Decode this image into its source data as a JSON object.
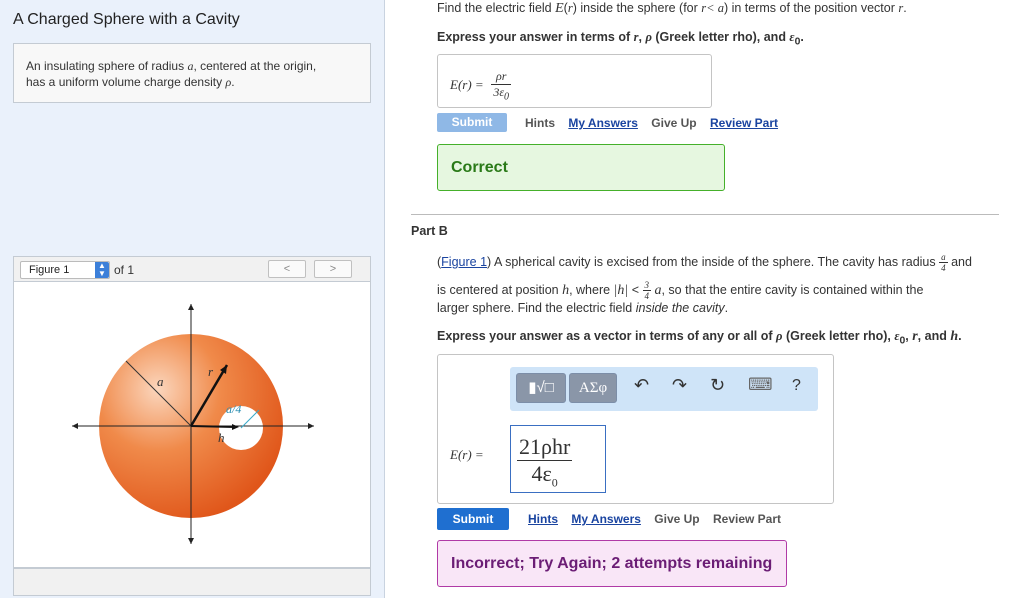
{
  "left": {
    "title": "A Charged Sphere with a Cavity",
    "intro_text_1": "An insulating sphere of radius ",
    "intro_var_a": "a",
    "intro_text_2": ", centered at the origin,",
    "intro_text_3": "has a uniform volume charge density ",
    "intro_var_rho": "ρ",
    "intro_text_4": ".",
    "figure_select": "Figure 1",
    "figure_of": "of 1",
    "figure_prev": "<",
    "figure_next": ">",
    "figure_labels": {
      "a": "a",
      "r": "r",
      "h": "h",
      "cavity_radius": "a/4"
    }
  },
  "partA": {
    "prompt_pre": "Find the electric field ",
    "prompt_E": "E",
    "prompt_r": "r",
    "prompt_mid": " inside the sphere (for ",
    "prompt_cond": "r< a",
    "prompt_post": ") in terms of the position vector ",
    "prompt_r2": "r",
    "prompt_end": ".",
    "express": "Express your answer in terms of ",
    "express_r": "r",
    "express_rho": "ρ",
    "express_mid": " (Greek letter rho), and ",
    "express_eps": "ε",
    "express_eps_sub": "0",
    "express_end": ".",
    "answer_lhs": "E(r) =",
    "answer_num": "ρr",
    "answer_den": "3ε",
    "answer_den_sub": "0",
    "submit": "Submit",
    "hints": "Hints",
    "my_answers": "My Answers",
    "give_up": "Give Up",
    "review_part": "Review Part",
    "feedback": "Correct"
  },
  "partB": {
    "heading": "Part B",
    "figure_link": "Figure 1",
    "text_1": ") A spherical cavity is excised from the inside of the sphere. The cavity has radius ",
    "frac_a": "a",
    "frac_4": "4",
    "text_and": " and",
    "text_2": "is centered at position ",
    "h": "h",
    "text_3": ", where ",
    "abs_h": "|h|",
    "lt": " < ",
    "frac_3": "3",
    "frac_4b": "4",
    "a2": "a",
    "text_4": ", so that the entire cavity is contained within the",
    "text_5": "larger sphere. Find the electric field ",
    "inside_cavity": "inside the cavity",
    "text_6": ".",
    "express_1": "Express your answer as a vector in terms of any or all of ",
    "rho": "ρ",
    "express_2": " (Greek letter rho), ",
    "eps": "ε",
    "eps_sub": "0",
    "comma": ", ",
    "r": "r",
    "express_3": ", and ",
    "h2": "h",
    "express_end": ".",
    "toolbar_template": "▮√□",
    "toolbar_greek": "ΑΣφ",
    "toolbar_undo": "↶",
    "toolbar_redo": "↷",
    "toolbar_reset": "↻",
    "toolbar_keyboard": "⌨",
    "toolbar_help": "?",
    "answer_lhs": "E(r) =",
    "answer_num": "21ρhr",
    "answer_den": "4ε",
    "answer_den_sub": "0",
    "submit": "Submit",
    "hints": "Hints",
    "my_answers": "My Answers",
    "give_up": "Give Up",
    "review_part": "Review Part",
    "feedback": "Incorrect; Try Again; 2 attempts remaining"
  },
  "colors": {
    "submit_active": "#1f6fd0",
    "submit_disabled": "#8fb8e6",
    "correct_bg": "#e6f7e0",
    "correct_border": "#45b02a",
    "correct_text": "#2a7a18",
    "incorrect_bg": "#f9e6f7",
    "incorrect_border": "#b03aa6",
    "incorrect_text": "#6b1d75",
    "sphere_outer": "#e8621f",
    "sphere_inner": "#f8c7a6"
  }
}
